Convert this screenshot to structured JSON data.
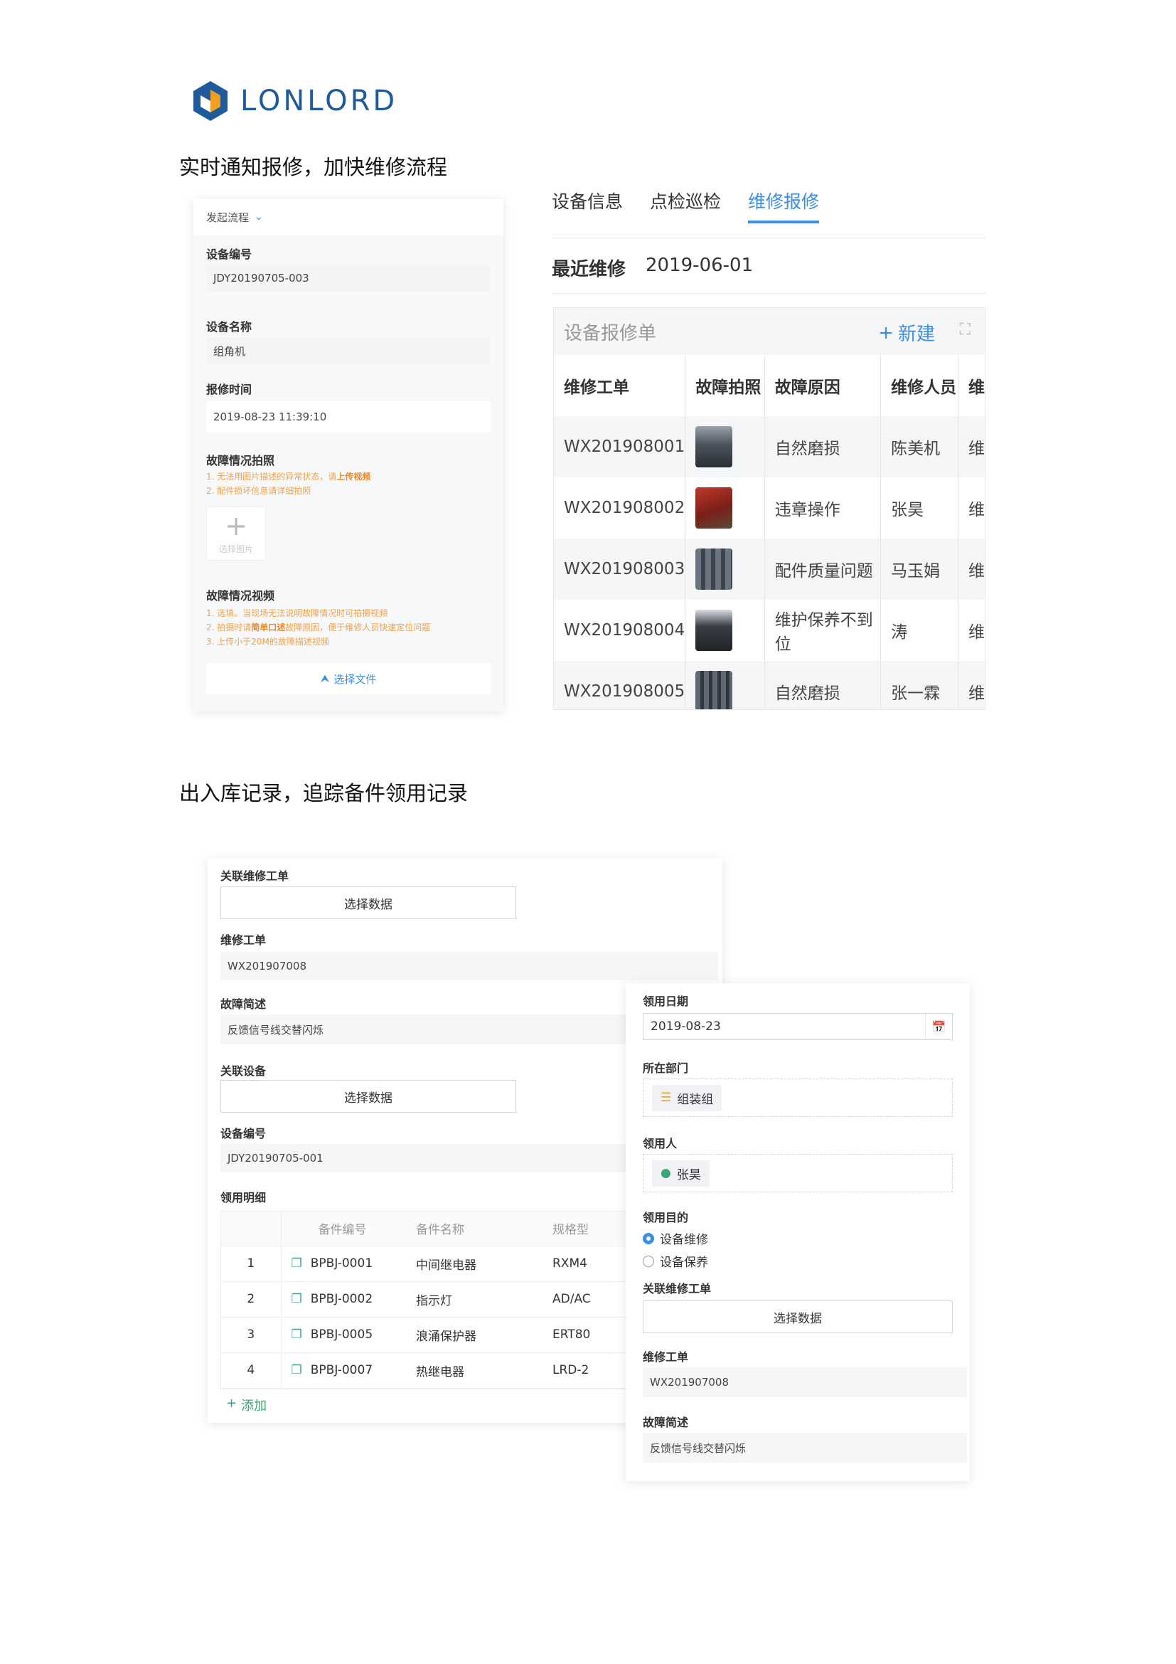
{
  "brand": {
    "name": "LONLORD",
    "primary": "#1f5a9c",
    "accent": "#f0a020"
  },
  "headings": {
    "h1": "实时通知报修，加快维修流程",
    "h2": "出入库记录，追踪备件领用记录"
  },
  "repair_form": {
    "flow_label": "发起流程",
    "device_no_label": "设备编号",
    "device_no_value": "JDY20190705-003",
    "device_name_label": "设备名称",
    "device_name_value": "组角机",
    "report_time_label": "报修时间",
    "report_time_value": "2019-08-23 11:39:10",
    "fault_photo_label": "故障情况拍照",
    "photo_hint_1a": "1. 无法用图片描述的异常状态，请",
    "photo_hint_1b": "上传视频",
    "photo_hint_2": "2. 配件损坏信息请详细拍照",
    "select_image": "选择图片",
    "fault_video_label": "故障情况视频",
    "video_hint_1": "1. 选填。当现场无法说明故障情况时可拍摄视频",
    "video_hint_2a": "2. 拍摄时请",
    "video_hint_2b": "简单口述",
    "video_hint_2c": "故障原因，便于维修人员快速定位问题",
    "video_hint_3": "3. 上传小于20M的故障描述视频",
    "select_file": "选择文件"
  },
  "device_tabs": {
    "tabs": [
      "设备信息",
      "点检巡检",
      "维修报修"
    ],
    "active": "维修报修",
    "recent_label": "最近维修",
    "recent_date": "2019-06-01",
    "table_title": "设备报修单",
    "new_button": "新建",
    "columns": [
      "维修工单",
      "故障拍照",
      "故障原因",
      "维修人员",
      "维"
    ],
    "rows": [
      {
        "order": "WX201908001",
        "reason": "自然磨损",
        "person": "陈美机",
        "more": "维"
      },
      {
        "order": "WX201908002",
        "reason": "违章操作",
        "person": "张昊",
        "more": "维"
      },
      {
        "order": "WX201908003",
        "reason": "配件质量问题",
        "person": "马玉娟",
        "more": "维"
      },
      {
        "order": "WX201908004",
        "reason": "维护保养不到位",
        "person": "涛",
        "more": "维"
      },
      {
        "order": "WX201908005",
        "reason": "自然磨损",
        "person": "张一霖",
        "more": "维"
      }
    ]
  },
  "stock_form": {
    "assoc_order_label": "关联维修工单",
    "select_data": "选择数据",
    "order_label": "维修工单",
    "order_value": "WX201907008",
    "fault_desc_label": "故障简述",
    "fault_desc_value": "反馈信号线交替闪烁",
    "assoc_device_label": "关联设备",
    "device_no_label": "设备编号",
    "device_no_value": "JDY20190705-001",
    "detail_label": "领用明细",
    "columns": [
      "备件编号",
      "备件名称",
      "规格型"
    ],
    "rows": [
      {
        "no": "1",
        "code": "BPBJ-0001",
        "name": "中间继电器",
        "spec": "RXM4"
      },
      {
        "no": "2",
        "code": "BPBJ-0002",
        "name": "指示灯",
        "spec": "AD/AC"
      },
      {
        "no": "3",
        "code": "BPBJ-0005",
        "name": "浪涌保护器",
        "spec": "ERT80"
      },
      {
        "no": "4",
        "code": "BPBJ-0007",
        "name": "热继电器",
        "spec": "LRD-2"
      }
    ],
    "add_label": "添加"
  },
  "receive_form": {
    "date_label": "领用日期",
    "date_value": "2019-08-23",
    "dept_label": "所在部门",
    "dept_value": "组装组",
    "person_label": "领用人",
    "person_value": "张昊",
    "purpose_label": "领用目的",
    "purpose_options": [
      "设备维修",
      "设备保养"
    ],
    "purpose_selected": "设备维修",
    "assoc_order_label": "关联维修工单",
    "select_data": "选择数据",
    "order_label": "维修工单",
    "order_value": "WX201907008",
    "fault_desc_label": "故障简述",
    "fault_desc_value": "反馈信号线交替闪烁"
  }
}
